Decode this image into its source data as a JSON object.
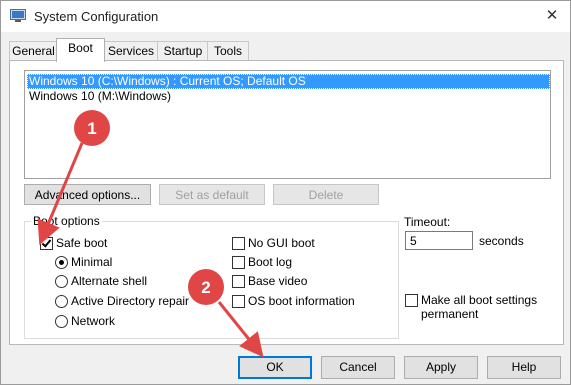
{
  "window": {
    "title": "System Configuration",
    "close_glyph": "✕"
  },
  "tabs": [
    {
      "label": "General"
    },
    {
      "label": "Boot"
    },
    {
      "label": "Services"
    },
    {
      "label": "Startup"
    },
    {
      "label": "Tools"
    }
  ],
  "boot": {
    "os_entries": [
      {
        "label": "Windows 10 (C:\\Windows) : Current OS; Default OS",
        "selected": true
      },
      {
        "label": "Windows 10 (M:\\Windows)",
        "selected": false
      }
    ],
    "advanced_button": "Advanced options...",
    "set_default_button": "Set as default",
    "delete_button": "Delete",
    "options_legend": "Boot options",
    "safe_boot": {
      "label": "Safe boot",
      "checked": true
    },
    "safe_modes": [
      {
        "label": "Minimal",
        "checked": true
      },
      {
        "label": "Alternate shell",
        "checked": false
      },
      {
        "label": "Active Directory repair",
        "checked": false
      },
      {
        "label": "Network",
        "checked": false
      }
    ],
    "extra_options": [
      {
        "label": "No GUI boot",
        "checked": false
      },
      {
        "label": "Boot log",
        "checked": false
      },
      {
        "label": "Base video",
        "checked": false
      },
      {
        "label": "OS boot information",
        "checked": false
      }
    ],
    "timeout_label": "Timeout:",
    "timeout_value": "5",
    "timeout_unit": "seconds",
    "permanent_label": "Make all boot settings permanent"
  },
  "footer": {
    "ok": "OK",
    "cancel": "Cancel",
    "apply": "Apply",
    "help": "Help"
  },
  "annotations": [
    {
      "number": "1"
    },
    {
      "number": "2"
    }
  ],
  "colors": {
    "selection": "#3399ff",
    "annotation": "#e04646"
  }
}
